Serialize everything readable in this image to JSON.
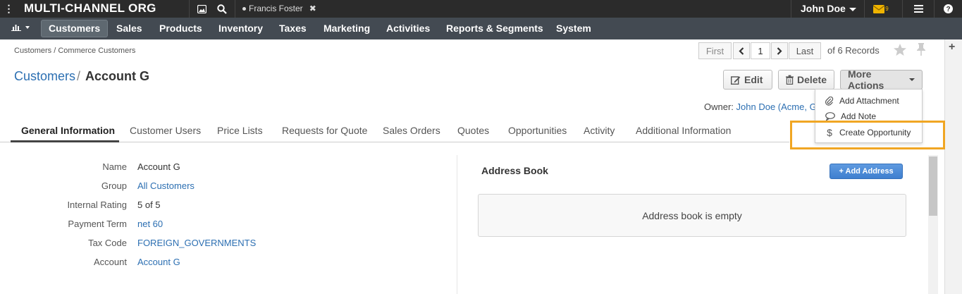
{
  "topbar": {
    "org_name": "MULTI-CHANNEL ORG",
    "pinned_tab": "Francis Foster",
    "user_name": "John Doe",
    "mail_count": "9"
  },
  "nav": {
    "items": [
      "Customers",
      "Sales",
      "Products",
      "Inventory",
      "Taxes",
      "Marketing",
      "Activities",
      "Reports & Segments",
      "System"
    ]
  },
  "breadcrumb": "Customers / Commerce Customers",
  "pager": {
    "first": "First",
    "page": "1",
    "last": "Last",
    "records": "of 6 Records"
  },
  "title": {
    "section": "Customers",
    "separator": "/",
    "name": "Account G"
  },
  "actions": {
    "edit": "Edit",
    "delete": "Delete",
    "more": "More Actions",
    "menu": [
      "Add Attachment",
      "Add Note",
      "Create Opportunity"
    ]
  },
  "owner": {
    "label": "Owner:",
    "value": "John Doe (Acme, G"
  },
  "tabs": [
    "General Information",
    "Customer Users",
    "Price Lists",
    "Requests for Quote",
    "Sales Orders",
    "Quotes",
    "Opportunities",
    "Activity",
    "Additional Information"
  ],
  "fields": [
    {
      "label": "Name",
      "value": "Account G"
    },
    {
      "label": "Group",
      "value": "All Customers"
    },
    {
      "label": "Internal Rating",
      "value": "5 of 5"
    },
    {
      "label": "Payment Term",
      "value": "net 60"
    },
    {
      "label": "Tax Code",
      "value": "FOREIGN_GOVERNMENTS"
    },
    {
      "label": "Account",
      "value": "Account G"
    }
  ],
  "address_book": {
    "title": "Address Book",
    "add_button": "+ Add Address",
    "empty_text": "Address book is empty"
  },
  "colors": {
    "link": "#2c6fb2",
    "highlight": "#f0a623",
    "nav_bg": "#434a52",
    "topbar_bg": "#2b2b2b"
  }
}
